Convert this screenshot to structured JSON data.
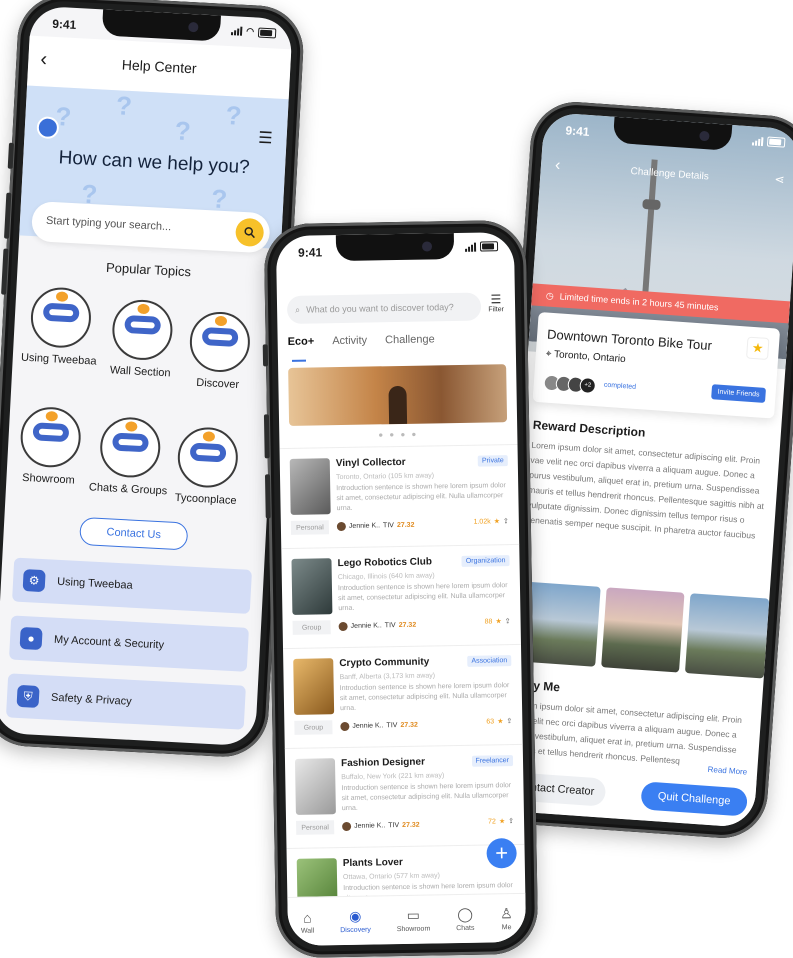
{
  "phone1": {
    "time": "9:41",
    "header_title": "Help Center",
    "heading": "How can we help you?",
    "search_placeholder": "Start typing your search...",
    "popular_title": "Popular Topics",
    "topics": [
      "Using Tweebaa",
      "Wall Section",
      "Discover",
      "Showroom",
      "Chats & Groups",
      "Tycoonplace"
    ],
    "contact_label": "Contact Us",
    "menu_items": [
      "Using Tweebaa",
      "My Account & Security",
      "Safety & Privacy"
    ]
  },
  "phone2": {
    "time": "9:41",
    "search_placeholder": "What do you want to discover today?",
    "filter_label": "Filter",
    "tabs": [
      "Eco+",
      "Activity",
      "Challenge"
    ],
    "cards": [
      {
        "name": "Vinyl Collector",
        "tag": "Private",
        "location": "Toronto, Ontario (105 km away)",
        "desc": "Introduction sentence is shown here lorem ipsum dolor sit amet, consectetur adipiscing elit. Nulla ullamcorper urna.",
        "kind": "Personal",
        "user": "Jennie K..",
        "tiv": "27.32",
        "score": "1.02k"
      },
      {
        "name": "Lego Robotics Club",
        "tag": "Organization",
        "location": "Chicago, Illinois (640 km away)",
        "desc": "Introduction sentence is shown here lorem ipsum dolor sit amet, consectetur adipiscing elit. Nulla ullamcorper urna.",
        "kind": "Group",
        "user": "Jennie K..",
        "tiv": "27.32",
        "score": "88"
      },
      {
        "name": "Crypto Community",
        "tag": "Association",
        "location": "Banff, Alberta (3,173 km away)",
        "desc": "Introduction sentence is shown here lorem ipsum dolor sit amet, consectetur adipiscing elit. Nulla ullamcorper urna.",
        "kind": "Group",
        "user": "Jennie K..",
        "tiv": "27.32",
        "score": "63"
      },
      {
        "name": "Fashion Designer",
        "tag": "Freelancer",
        "location": "Buffalo, New York (221 km away)",
        "desc": "Introduction sentence is shown here lorem ipsum dolor sit amet, consectetur adipiscing elit. Nulla ullamcorper urna.",
        "kind": "Personal",
        "user": "Jennie K..",
        "tiv": "27.32",
        "score": "72"
      },
      {
        "name": "Plants Lover",
        "tag": "",
        "location": "Ottawa, Ontario (577 km away)",
        "desc": "Introduction sentence is shown here lorem ipsum dolor sit amet.",
        "kind": "",
        "user": "",
        "tiv": "",
        "score": ""
      }
    ],
    "tiv_prefix": "TIV",
    "nav": [
      "Wall",
      "Discovery",
      "Showroom",
      "Chats",
      "Me"
    ]
  },
  "phone3": {
    "time": "9:41",
    "title": "Challenge Details",
    "limit_text": "Limited time ends in 2 hours 45 minutes",
    "challenge_title": "Downtown Toronto Bike Tour",
    "place": "Toronto, Ontario",
    "avatar_count": "+2",
    "completed": "completed",
    "invite_label": "Invite Friends",
    "reward_title": "Reward Description",
    "reward_text": "Lorem ipsum dolor sit amet, consectetur adipiscing elit. Proin vae velit nec orci dapibus viverra a aliquam augue. Donec a purus vestibulum, aliquet erat in, pretium urna. Suspendissea mauris et tellus hendrerit rhoncus. Pellentesque sagittis nibh at vulputate dignissim. Donec dignissim tellus tempor risus o venenatis semper neque suscipit. In pharetra auctor faucibus",
    "why_title": "Why Me",
    "why_text": "Lorem ipsum dolor sit amet, consectetur adipiscing elit. Proin vae velit nec orci dapibus viverra a aliquam augue. Donec a purus vestibulum, aliquet erat in, pretium urna. Suspendisse mauris et tellus hendrerit rhoncus. Pellentesq",
    "read_more": "Read More",
    "contact_creator": "Contact Creator",
    "quit_challenge": "Quit Challenge"
  },
  "colors": {
    "accent": "#3a7ff2",
    "banner_red": "#f06a62",
    "help_blue": "#cfe0f7",
    "menu_blue": "#d4ddf6"
  }
}
